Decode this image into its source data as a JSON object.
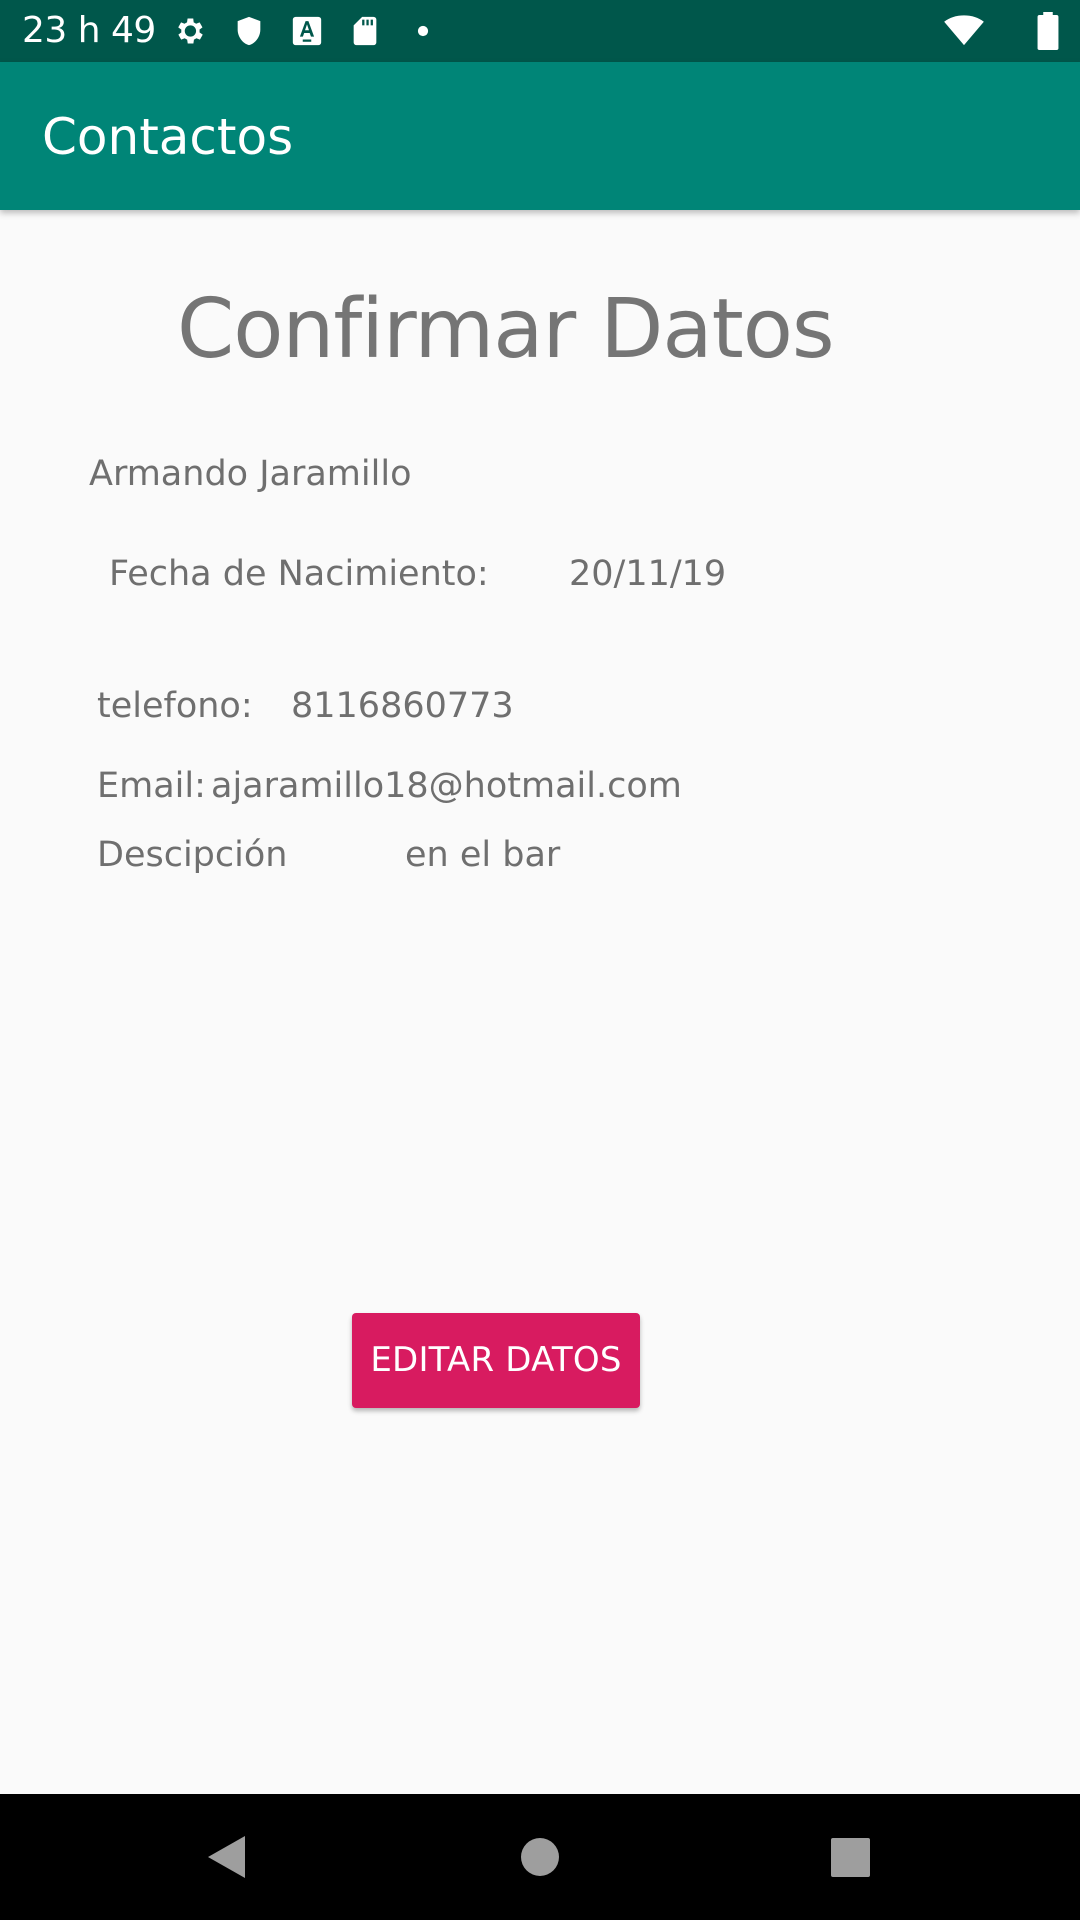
{
  "status_bar": {
    "time": "23 h 49",
    "icons": [
      "settings-icon",
      "shield-icon",
      "font-download-icon",
      "sd-card-icon",
      "notification-dot-icon",
      "wifi-icon",
      "battery-icon"
    ]
  },
  "app_bar": {
    "title": "Contactos"
  },
  "main": {
    "title": "Confirmar Datos",
    "name": "Armando Jaramillo",
    "birth_label": "Fecha de Nacimiento:",
    "birth_value": "20/11/19",
    "phone_label": "telefono:",
    "phone_value": "8116860773",
    "email_label": "Email:",
    "email_value": "ajaramillo18@hotmail.com",
    "description_label": "Descipción",
    "description_value": "en el bar",
    "edit_button_label": "EDITAR DATOS"
  },
  "nav_bar": {
    "icons": [
      "back-icon",
      "home-icon",
      "recents-icon"
    ]
  },
  "colors": {
    "status_bar": "#00574b",
    "app_bar": "#008577",
    "accent": "#d81b60",
    "background": "#fafafa",
    "text": "#6f6f6f"
  }
}
